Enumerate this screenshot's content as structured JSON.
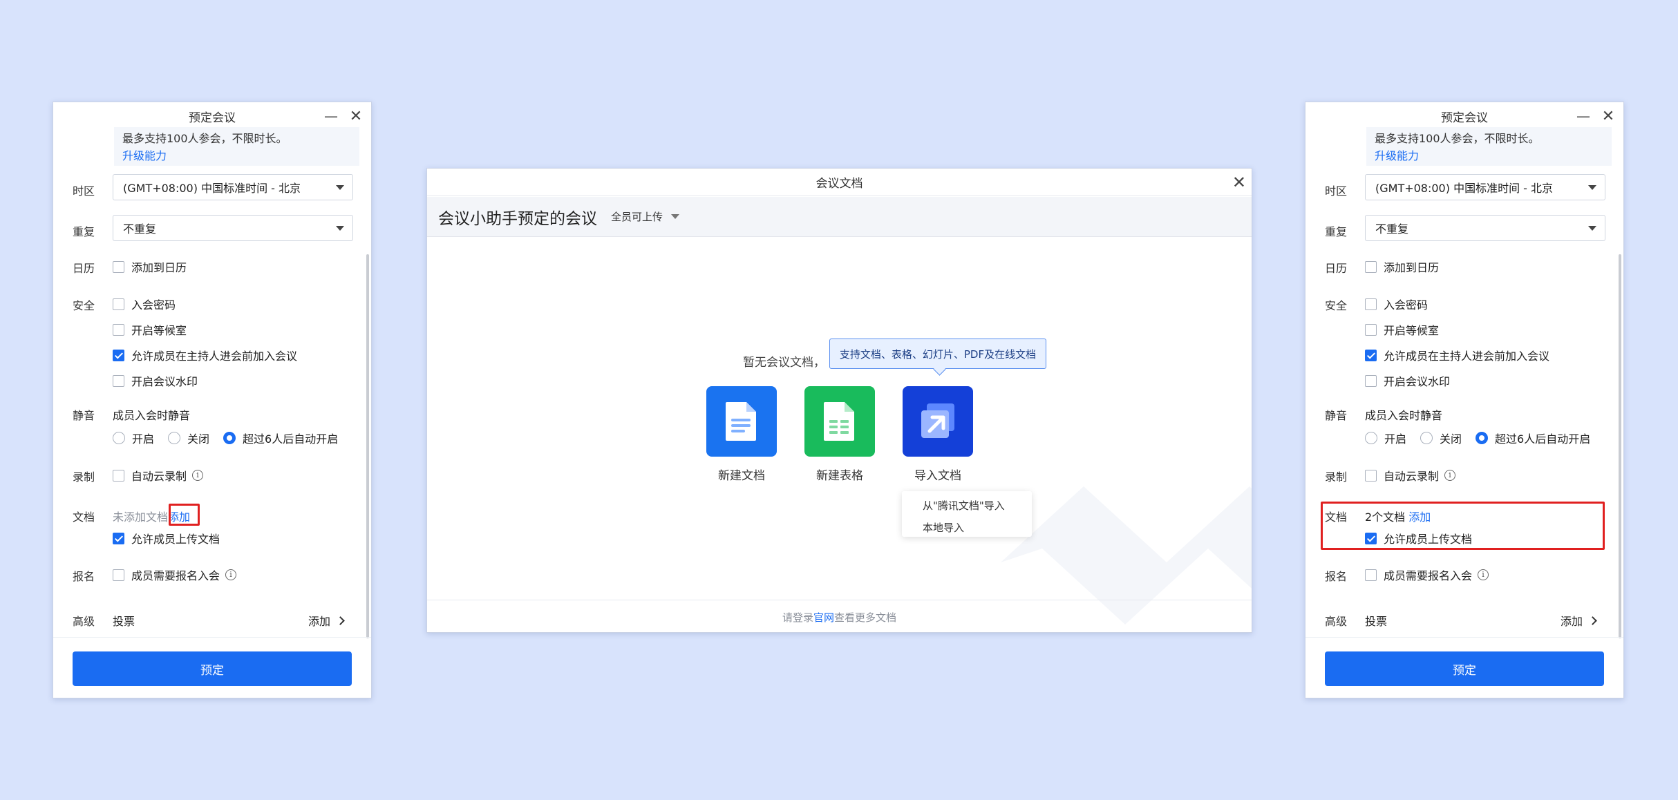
{
  "schedule": {
    "title": "预定会议",
    "upgrade_text": "最多支持100人参会，不限时长。",
    "upgrade_link": "升级能力",
    "timezone_label": "时区",
    "timezone_value": "(GMT+08:00) 中国标准时间 - 北京",
    "repeat_label": "重复",
    "repeat_value": "不重复",
    "calendar_label": "日历",
    "calendar_option": "添加到日历",
    "security_label": "安全",
    "security_options": [
      "入会密码",
      "开启等候室",
      "允许成员在主持人进会前加入会议",
      "开启会议水印"
    ],
    "mute_label": "静音",
    "mute_desc": "成员入会时静音",
    "mute_options": [
      "开启",
      "关闭",
      "超过6人后自动开启"
    ],
    "record_label": "录制",
    "record_option": "自动云录制",
    "doc_label": "文档",
    "doc_status_empty": "未添加文档",
    "doc_status_filled": "2个文档",
    "doc_add": "添加",
    "doc_allow_upload": "允许成员上传文档",
    "signup_label": "报名",
    "signup_option": "成员需要报名入会",
    "advanced_label": "高级",
    "advanced_vote": "投票",
    "advanced_add": "添加",
    "submit": "预定",
    "info_glyph": "i",
    "minimize_glyph": "—",
    "close_glyph": "✕"
  },
  "docs_dialog": {
    "title": "会议文档",
    "meeting_name": "会议小助手预定的会议",
    "permission": "全员可上传",
    "empty_text": "暂无会议文档，",
    "tooltip": "支持文档、表格、幻灯片、PDF及在线文档",
    "tiles": [
      "新建文档",
      "新建表格",
      "导入文档"
    ],
    "import_menu": [
      "从\"腾讯文档\"导入",
      "本地导入"
    ],
    "footer_prefix": "请登录",
    "footer_link": "官网",
    "footer_suffix": "查看更多文档",
    "close_glyph": "✕"
  },
  "colors": {
    "accent": "#1a6cf2",
    "doc_tile": "#1a73f0",
    "sheet_tile": "#19bb5c",
    "import_tile": "#1440d8",
    "highlight": "#e02020"
  }
}
